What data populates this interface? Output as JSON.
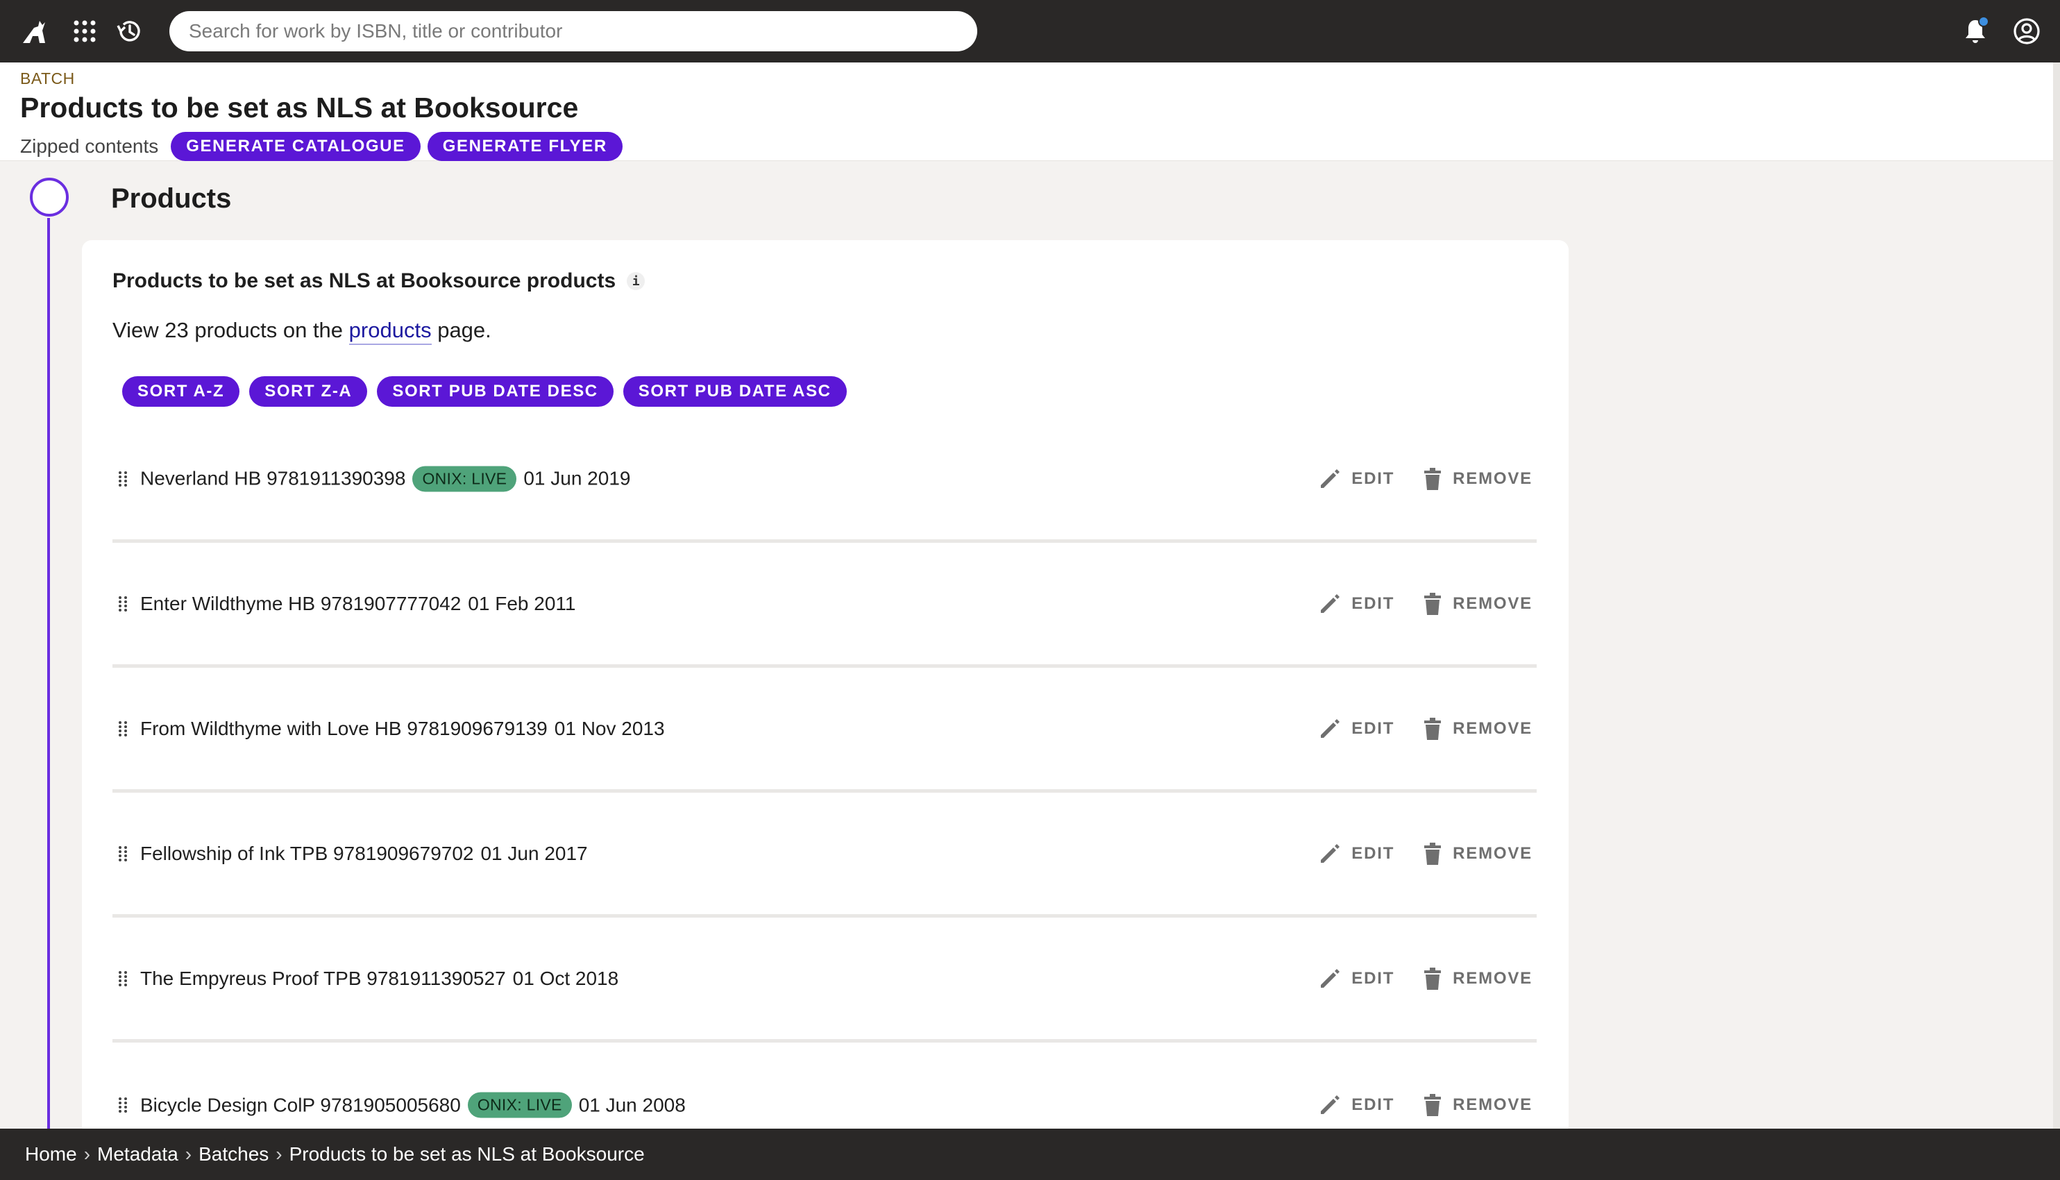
{
  "topbar": {
    "search_placeholder": "Search for work by ISBN, title or contributor"
  },
  "header": {
    "kicker": "BATCH",
    "title": "Products to be set as NLS at Booksource",
    "sub_label": "Zipped contents",
    "buttons": [
      "GENERATE CATALOGUE",
      "GENERATE FLYER"
    ]
  },
  "section": {
    "title": "Products"
  },
  "card": {
    "title": "Products to be set as NLS at Booksource products",
    "info": "i",
    "desc_prefix": "View 23 products on the",
    "desc_link": "products",
    "desc_suffix": "page.",
    "sort_buttons": [
      "SORT A-Z",
      "SORT Z-A",
      "SORT PUB DATE DESC",
      "SORT PUB DATE ASC"
    ],
    "edit_label": "EDIT",
    "remove_label": "REMOVE"
  },
  "products": [
    {
      "title": "Neverland HB 9781911390398",
      "badge": "ONIX: LIVE",
      "date": "01 Jun 2019"
    },
    {
      "title": "Enter Wildthyme HB 9781907777042",
      "badge": "",
      "date": "01 Feb 2011"
    },
    {
      "title": "From Wildthyme with Love HB 9781909679139",
      "badge": "",
      "date": "01 Nov 2013"
    },
    {
      "title": "Fellowship of Ink TPB 9781909679702",
      "badge": "",
      "date": "01 Jun 2017"
    },
    {
      "title": "The Empyreus Proof TPB 9781911390527",
      "badge": "",
      "date": "01 Oct 2018"
    },
    {
      "title": "Bicycle Design ColP 9781905005680",
      "badge": "ONIX: LIVE",
      "date": "01 Jun 2008"
    }
  ],
  "breadcrumb": [
    "Home",
    "Metadata",
    "Batches",
    "Products to be set as NLS at Booksource"
  ],
  "colors": {
    "accent": "#5b17d6",
    "topbar": "#2a2827",
    "badge_green": "#4fa37a",
    "timeline": "#6a2ee0"
  }
}
